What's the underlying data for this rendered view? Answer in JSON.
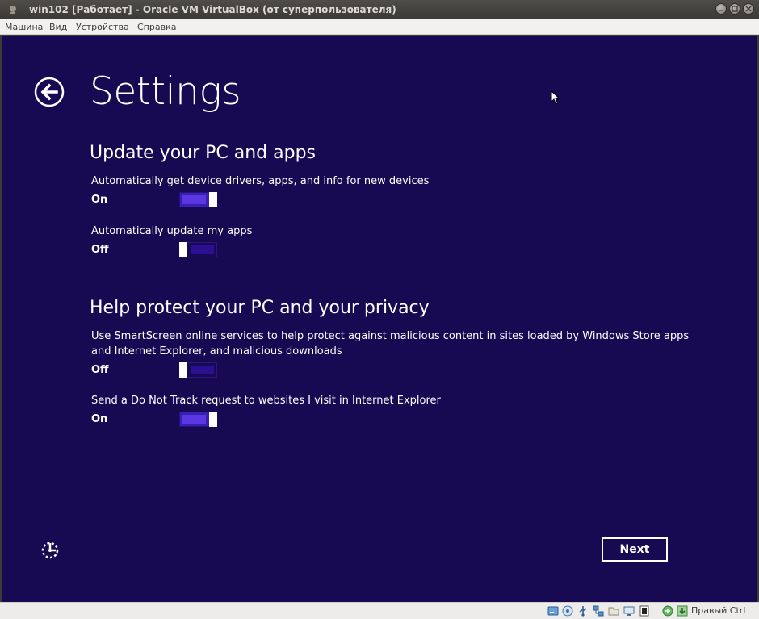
{
  "window": {
    "title": "win102 [Работает] - Oracle VM VirtualBox (от суперпользователя)"
  },
  "menubar": {
    "items": [
      "Машина",
      "Вид",
      "Устройства",
      "Справка"
    ]
  },
  "screen": {
    "page_title": "Settings",
    "sections": [
      {
        "title": "Update your PC and apps",
        "options": [
          {
            "description": "Automatically get device drivers, apps, and info for new devices",
            "state": "On"
          },
          {
            "description": "Automatically update my apps",
            "state": "Off"
          }
        ]
      },
      {
        "title": "Help protect your PC and your privacy",
        "options": [
          {
            "description_line1": "Use SmartScreen online services to help protect against malicious content in sites loaded by Windows Store apps",
            "description_line2": "and Internet Explorer, and malicious downloads",
            "state": "Off"
          },
          {
            "description": "Send a Do Not Track request to websites I visit in Internet Explorer",
            "state": "On"
          }
        ]
      }
    ],
    "next_button": "Next"
  },
  "statusbar": {
    "icons": [
      "harddisk-icon",
      "optical-drive-icon",
      "usb-icon",
      "network-icon",
      "shared-folder-icon",
      "display-icon",
      "video-capture-icon",
      "mouse-integration-icon",
      "host-key-arrow-icon"
    ],
    "host_key": "Правый Ctrl"
  },
  "colors": {
    "background": "#180a52",
    "toggle_on": "#3a1fb5",
    "text": "#ffffff"
  }
}
